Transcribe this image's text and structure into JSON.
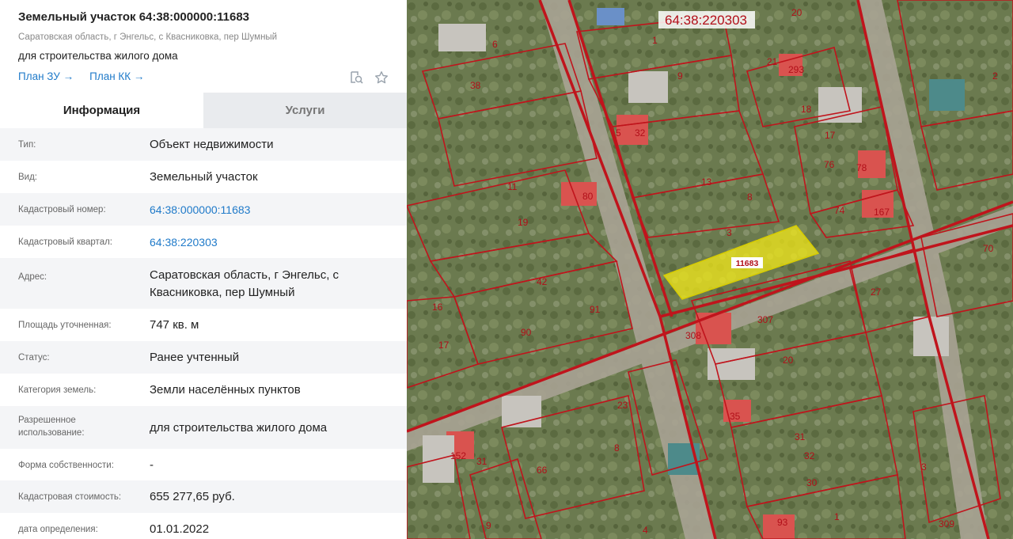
{
  "panel": {
    "title": "Земельный участок 64:38:000000:11683",
    "address_sub": "Саратовская область, г Энгельс, с Квасниковка, пер Шумный",
    "purpose": "для строительства жилого дома",
    "links": [
      {
        "label": "План ЗУ →"
      },
      {
        "label": "План КК →"
      }
    ],
    "tabs": [
      {
        "label": "Информация",
        "active": true
      },
      {
        "label": "Услуги",
        "active": false
      }
    ],
    "rows": [
      {
        "label": "Тип:",
        "value": "Объект недвижимости",
        "link": false
      },
      {
        "label": "Вид:",
        "value": "Земельный участок",
        "link": false
      },
      {
        "label": "Кадастровый номер:",
        "value": "64:38:000000:11683",
        "link": true
      },
      {
        "label": "Кадастровый квартал:",
        "value": "64:38:220303",
        "link": true
      },
      {
        "label": "Адрес:",
        "value": "Саратовская область, г Энгельс, с Квасниковка, пер Шумный",
        "link": false
      },
      {
        "label": "Площадь уточненная:",
        "value": "747 кв. м",
        "link": false
      },
      {
        "label": "Статус:",
        "value": "Ранее учтенный",
        "link": false
      },
      {
        "label": "Категория земель:",
        "value": "Земли населённых пунктов",
        "link": false
      },
      {
        "label": "Разрешенное использование:",
        "value": "для строительства жилого дома",
        "link": false
      },
      {
        "label": "Форма собственности:",
        "value": "-",
        "link": false
      },
      {
        "label": "Кадастровая стоимость:",
        "value": "655 277,65 руб.",
        "link": false
      },
      {
        "label": "дата определения:",
        "value": "01.01.2022",
        "link": false
      }
    ]
  },
  "map": {
    "quarter_label": "64:38:220303",
    "selected_parcel_label": "11683",
    "parcel_numbers": [
      "20",
      "6",
      "1",
      "21",
      "293",
      "2",
      "38",
      "9",
      "18",
      "5",
      "32",
      "17",
      "76",
      "78",
      "11",
      "80",
      "13",
      "8",
      "167",
      "19",
      "3",
      "74",
      "70",
      "42",
      "27",
      "16",
      "91",
      "307",
      "308",
      "17",
      "90",
      "20",
      "35",
      "23",
      "8",
      "31",
      "152",
      "31",
      "32",
      "66",
      "30",
      "3",
      "93",
      "1",
      "309",
      "9",
      "4"
    ],
    "colors": {
      "boundary": "#c0141c",
      "selected_fill": "#f3ea19",
      "link": "#1f7ac9"
    }
  }
}
